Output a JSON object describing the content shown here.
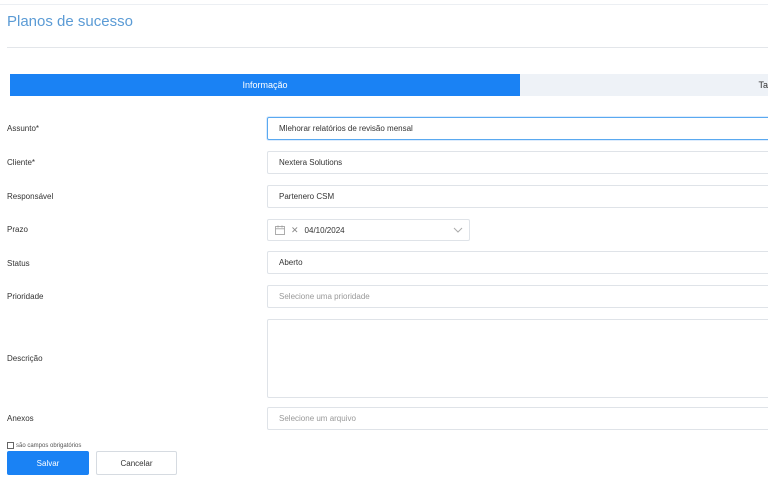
{
  "page": {
    "title": "Planos de sucesso"
  },
  "tabs": [
    {
      "label": "Informação",
      "active": true
    },
    {
      "label": "Ta",
      "active": false
    }
  ],
  "form": {
    "subject": {
      "label": "Assunto*",
      "value": "Mlehorar relatórios de revisão mensal"
    },
    "client": {
      "label": "Cliente*",
      "value": "Nextera Solutions"
    },
    "owner": {
      "label": "Responsável",
      "value": "Partenero CSM"
    },
    "deadline": {
      "label": "Prazo",
      "value": "04/10/2024"
    },
    "status": {
      "label": "Status",
      "value": "Aberto"
    },
    "priority": {
      "label": "Prioridade",
      "placeholder": "Selecione uma prioridade"
    },
    "description": {
      "label": "Descrição",
      "value": ""
    },
    "attachments": {
      "label": "Anexos",
      "placeholder": "Selecione um arquivo"
    }
  },
  "required_note": "são campos obrigatórios",
  "buttons": {
    "save": "Salvar",
    "cancel": "Cancelar"
  },
  "colors": {
    "accent": "#1a82f4",
    "title": "#5b9bd5",
    "tab_inactive_bg": "#eef2f7"
  },
  "icons": {
    "date": "calendar-icon",
    "clear": "close-icon",
    "dropdown": "chevron-down-icon"
  }
}
